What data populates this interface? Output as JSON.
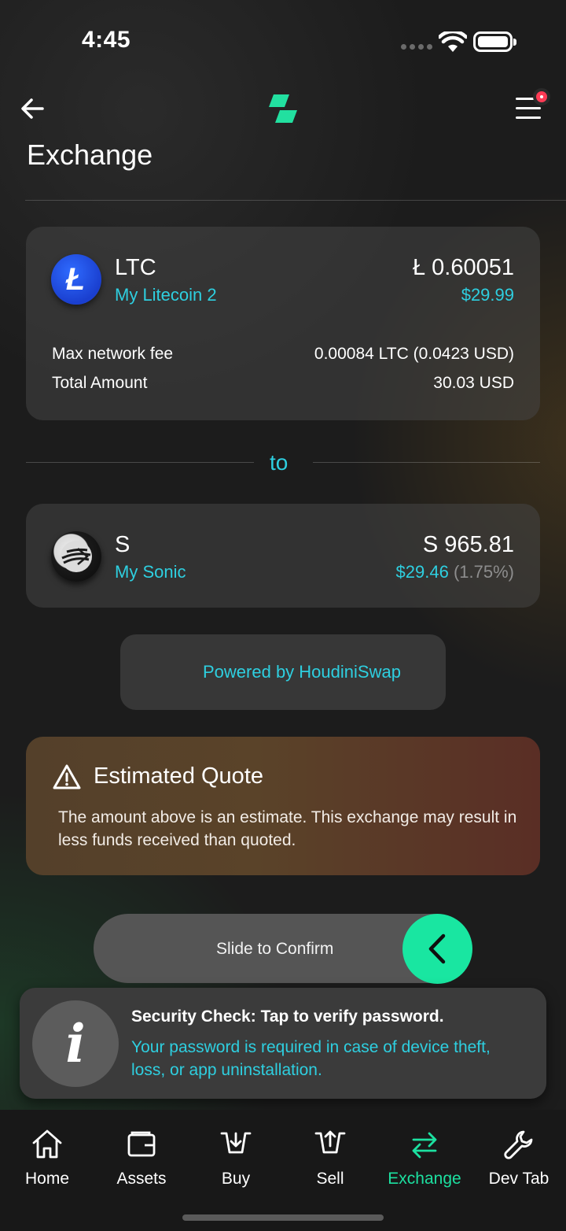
{
  "status_bar": {
    "time": "4:45"
  },
  "header": {
    "title": "Exchange"
  },
  "from": {
    "symbol": "LTC",
    "wallet": "My Litecoin 2",
    "amount": "Ł 0.60051",
    "usd": "$29.99",
    "rows": [
      {
        "label": "Max network fee",
        "value": "0.00084 LTC (0.0423 USD)"
      },
      {
        "label": "Total Amount",
        "value": "30.03 USD"
      }
    ],
    "icon": "litecoin-icon"
  },
  "separator": {
    "label": "to"
  },
  "to": {
    "symbol": "S",
    "wallet": "My Sonic",
    "amount": "S 965.81",
    "usd": "$29.46",
    "percent": "(1.75%)",
    "icon": "sonic-icon"
  },
  "powered_by": "Powered by HoudiniSwap",
  "warning": {
    "title": "Estimated Quote",
    "body": "The amount above is an estimate. This exchange may result in less funds received than quoted."
  },
  "slider": {
    "label": "Slide to Confirm"
  },
  "security": {
    "title": "Security Check: Tap to verify password.",
    "body": "Your password is required in case of device theft, loss, or app uninstallation."
  },
  "tabs": [
    {
      "label": "Home",
      "icon": "home-icon"
    },
    {
      "label": "Assets",
      "icon": "wallet-icon"
    },
    {
      "label": "Buy",
      "icon": "buy-icon"
    },
    {
      "label": "Sell",
      "icon": "sell-icon"
    },
    {
      "label": "Exchange",
      "icon": "exchange-icon",
      "active": true
    },
    {
      "label": "Dev Tab",
      "icon": "wrench-icon"
    }
  ],
  "colors": {
    "accent": "#2ecfe0",
    "active_tab": "#1ce0a0",
    "slider_knob": "#19e6a1",
    "notification_dot": "#ff3b55"
  }
}
